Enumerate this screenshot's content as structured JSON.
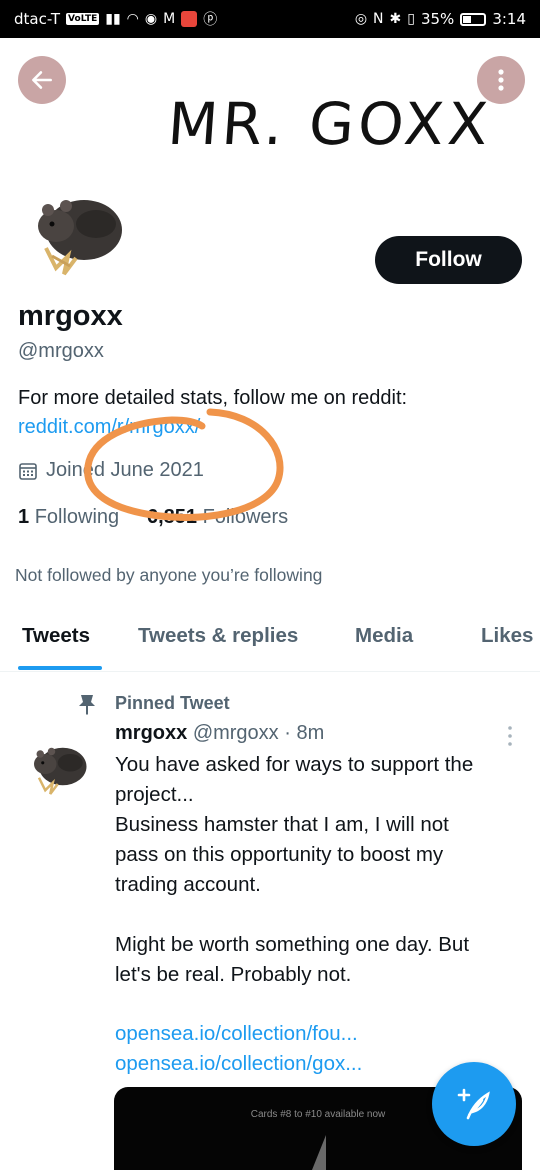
{
  "status_bar": {
    "carrier": "dtac-T",
    "volte": "VoLTE",
    "battery": "35%",
    "time": "3:14"
  },
  "header": {
    "banner_text": "MR. GOXX",
    "back_icon": "arrow-left-icon",
    "more_icon": "more-vertical-icon"
  },
  "profile": {
    "display_name": "mrgoxx",
    "handle": "@mrgoxx",
    "follow_label": "Follow",
    "bio_text": "For more detailed stats, follow me on reddit:",
    "bio_link": "reddit.com/r/mrgoxx/",
    "joined": "Joined June 2021",
    "following_count": "1",
    "following_label": "Following",
    "followers_count": "6,851",
    "followers_label": "Followers",
    "not_followed": "Not followed by anyone you’re following"
  },
  "tabs": [
    {
      "label": "Tweets",
      "active": true
    },
    {
      "label": "Tweets & replies",
      "active": false
    },
    {
      "label": "Media",
      "active": false
    },
    {
      "label": "Likes",
      "active": false
    }
  ],
  "tweet": {
    "pinned_label": "Pinned Tweet",
    "author_name": "mrgoxx",
    "author_handle": "@mrgoxx",
    "separator": "·",
    "time": "8m",
    "lines": [
      "You have asked for ways to support the",
      "project...",
      "Business hamster that I am, I will not",
      "pass on this opportunity to boost my",
      "trading account.",
      "",
      "Might be worth something one day. But",
      "let's be real. Probably not."
    ],
    "links": [
      "opensea.io/collection/fou...",
      "opensea.io/collection/gox..."
    ],
    "media_caption": "Cards #8 to #10 available now"
  },
  "colors": {
    "accent": "#1d9bf0",
    "text": "#0f1419",
    "muted": "#536471",
    "circle_annotation": "#f0944a"
  }
}
